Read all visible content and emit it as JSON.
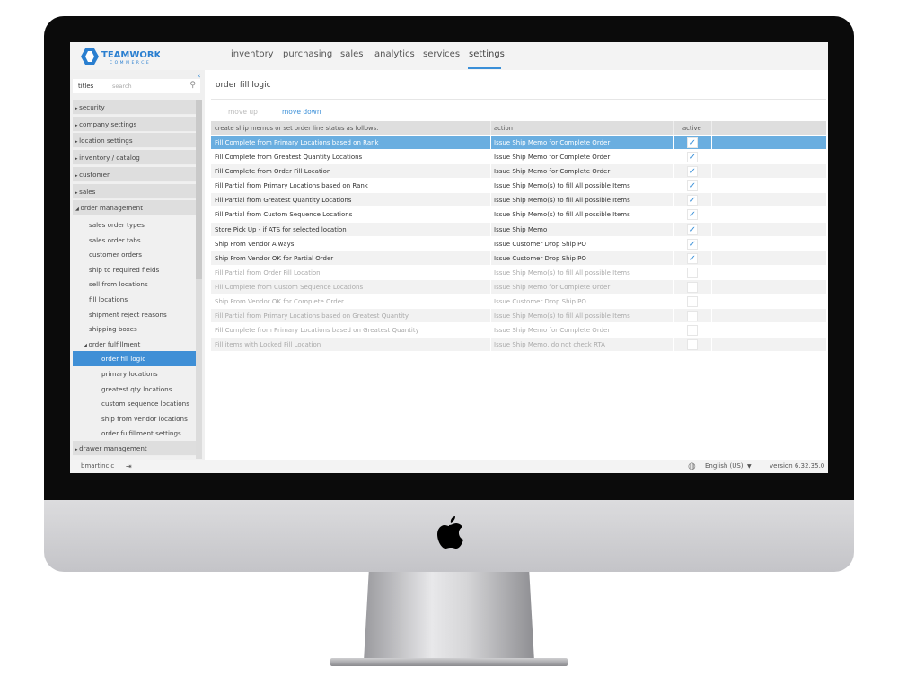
{
  "brand": {
    "name": "TEAMWORK",
    "sub": "COMMERCE",
    "accent": "#3a8fd8"
  },
  "nav": [
    {
      "label": "inventory"
    },
    {
      "label": "purchasing"
    },
    {
      "label": "sales"
    },
    {
      "label": "analytics"
    },
    {
      "label": "services"
    },
    {
      "label": "settings",
      "active": true
    }
  ],
  "sidebar": {
    "search_label": "titles",
    "search_placeholder": "search",
    "items": [
      {
        "label": "security",
        "type": "group"
      },
      {
        "label": "company settings",
        "type": "group"
      },
      {
        "label": "location settings",
        "type": "group"
      },
      {
        "label": "inventory / catalog",
        "type": "group"
      },
      {
        "label": "customer",
        "type": "group"
      },
      {
        "label": "sales",
        "type": "group"
      },
      {
        "label": "order management",
        "type": "group",
        "expanded": true
      },
      {
        "label": "sales order types",
        "level": 1
      },
      {
        "label": "sales order tabs",
        "level": 1
      },
      {
        "label": "customer orders",
        "level": 1
      },
      {
        "label": "ship to required fields",
        "level": 1
      },
      {
        "label": "sell from locations",
        "level": 1
      },
      {
        "label": "fill locations",
        "level": 1
      },
      {
        "label": "shipment reject reasons",
        "level": 1
      },
      {
        "label": "shipping boxes",
        "level": 1
      },
      {
        "label": "order fulfillment",
        "level": 1,
        "expanded": true
      },
      {
        "label": "order fill logic",
        "level": 2,
        "selected": true
      },
      {
        "label": "primary locations",
        "level": 2
      },
      {
        "label": "greatest qty locations",
        "level": 2
      },
      {
        "label": "custom sequence locations",
        "level": 2
      },
      {
        "label": "ship from vendor locations",
        "level": 2
      },
      {
        "label": "order fulfillment settings",
        "level": 2
      },
      {
        "label": "drawer management",
        "type": "group"
      }
    ]
  },
  "main": {
    "title": "order fill logic",
    "move_up": "move up",
    "move_down": "move down",
    "columns": [
      "create ship memos or set order line status as follows:",
      "action",
      "active"
    ],
    "rows": [
      {
        "rule": "Fill Complete from Primary Locations based on Rank",
        "action": "Issue Ship Memo for Complete Order",
        "active": true,
        "selected": true
      },
      {
        "rule": "Fill Complete from Greatest Quantity Locations",
        "action": "Issue Ship Memo for Complete Order",
        "active": true
      },
      {
        "rule": "Fill Complete from Order Fill Location",
        "action": "Issue Ship Memo for Complete Order",
        "active": true
      },
      {
        "rule": "Fill Partial from Primary Locations based on Rank",
        "action": "Issue Ship Memo(s) to fill All possible Items",
        "active": true
      },
      {
        "rule": "Fill Partial from Greatest Quantity Locations",
        "action": "Issue Ship Memo(s) to fill All possible Items",
        "active": true
      },
      {
        "rule": "Fill Partial from Custom Sequence Locations",
        "action": "Issue Ship Memo(s) to fill All possible Items",
        "active": true
      },
      {
        "rule": "Store Pick Up - if ATS for selected location",
        "action": "Issue Ship Memo",
        "active": true
      },
      {
        "rule": "Ship From Vendor Always",
        "action": "Issue Customer Drop Ship PO",
        "active": true
      },
      {
        "rule": "Ship From Vendor OK for Partial Order",
        "action": "Issue Customer Drop Ship PO",
        "active": true
      },
      {
        "rule": "Fill Partial from Order Fill Location",
        "action": "Issue Ship Memo(s) to fill All possible Items",
        "active": false
      },
      {
        "rule": "Fill Complete from Custom Sequence Locations",
        "action": "Issue Ship Memo for Complete Order",
        "active": false
      },
      {
        "rule": "Ship From Vendor OK for Complete Order",
        "action": "Issue Customer Drop Ship PO",
        "active": false
      },
      {
        "rule": "Fill Partial from Primary Locations based on Greatest Quantity",
        "action": "Issue Ship Memo(s) to fill All possible Items",
        "active": false
      },
      {
        "rule": "Fill Complete from Primary Locations based on Greatest Quantity",
        "action": "Issue Ship Memo for Complete Order",
        "active": false
      },
      {
        "rule": "Fill items with Locked Fill Location",
        "action": "Issue Ship Memo, do not check RTA",
        "active": false
      }
    ]
  },
  "footer": {
    "user": "bmartincic",
    "language": "English (US)",
    "version": "version 6.32.35.0"
  }
}
